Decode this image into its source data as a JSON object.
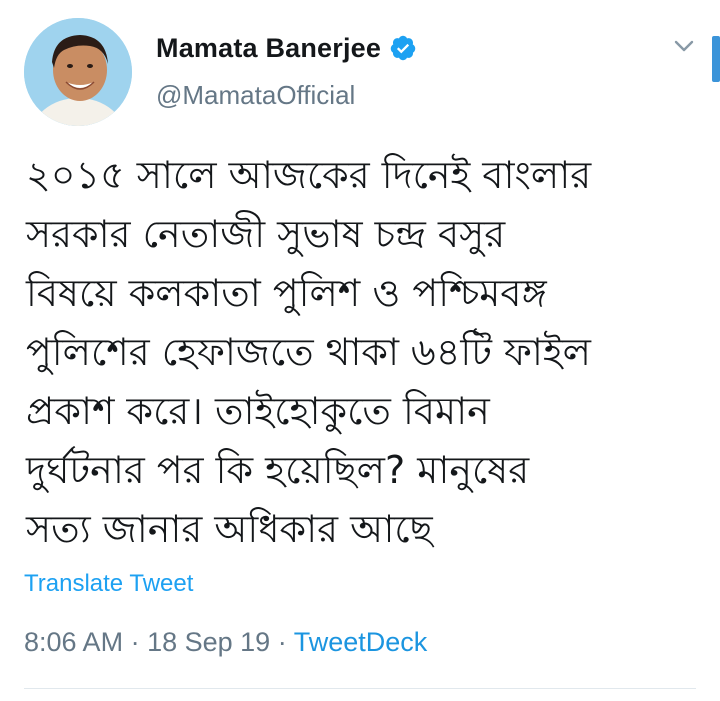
{
  "author": {
    "display_name": "Mamata Banerjee",
    "handle": "@MamataOfficial",
    "verified": true,
    "verified_icon": "verified-badge-icon",
    "avatar": "profile-photo"
  },
  "tweet": {
    "text_lines": [
      "২০১৫ সালে আজকের দিনেই বাংলার",
      "সরকার নেতাজী সুভাষ চন্দ্র বসুর",
      "বিষয়ে কলকাতা পুলিশ ও পশ্চিমবঙ্গ",
      "পুলিশের হেফাজতে থাকা ৬৪টি ফাইল",
      "প্রকাশ করে। তাইহোকুতে বিমান",
      "দুর্ঘটনার পর কি হয়েছিল? মানুষের",
      "সত্য জানার অধিকার আছে"
    ],
    "translate_label": "Translate Tweet",
    "time": "8:06 AM",
    "date": "18 Sep 19",
    "separator": "·",
    "source": "TweetDeck"
  },
  "colors": {
    "link_blue": "#1da1f2",
    "muted_gray": "#657786",
    "text": "#14171a",
    "verified_blue": "#1da1f2",
    "scrollbar": "#3b94d9"
  },
  "icons": {
    "menu": "chevron-down-icon"
  }
}
